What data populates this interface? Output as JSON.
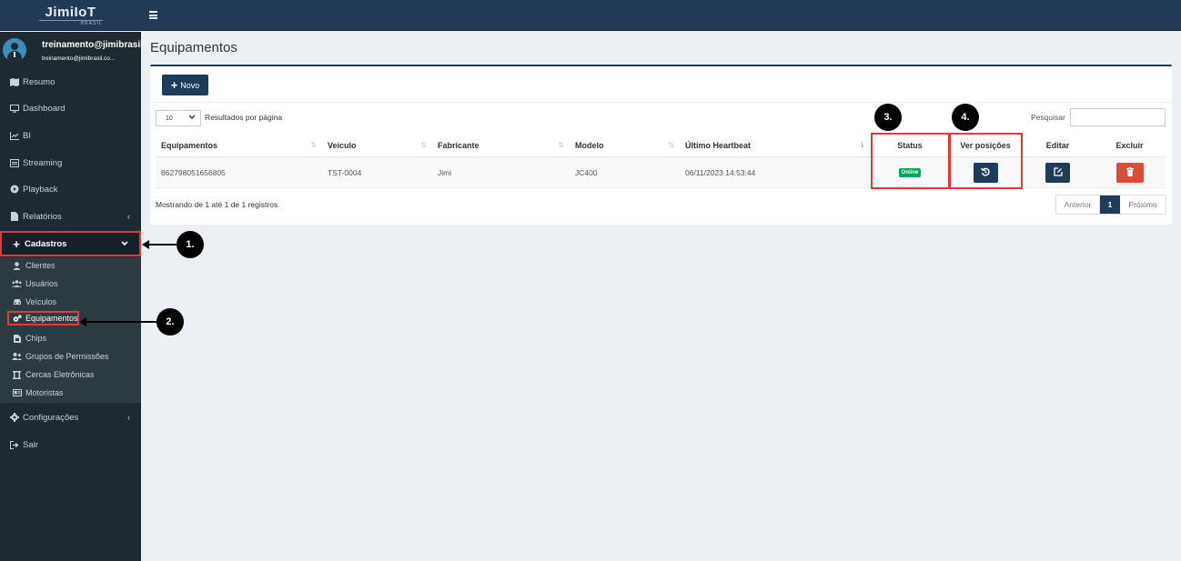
{
  "brand": {
    "logo": "JimiIoT",
    "logo_sub": "BRASIL"
  },
  "user": {
    "name": "treinamento@jimibrasil",
    "email": "treinamento@jimibrasil.co..."
  },
  "nav": {
    "resumo": "Resumo",
    "dashboard": "Dashboard",
    "bi": "BI",
    "streaming": "Streaming",
    "playback": "Playback",
    "relatorios": "Relatórios",
    "cadastros": "Cadastros",
    "configuracoes": "Configurações",
    "sair": "Sair"
  },
  "submenu": {
    "clientes": "Clientes",
    "usuarios": "Usuários",
    "veiculos": "Veículos",
    "equipamentos": "Equipamentos",
    "chips": "Chips",
    "grupos": "Grupos de Permissões",
    "cercas": "Cercas Eletrônicas",
    "motoristas": "Motoristas"
  },
  "page": {
    "title": "Equipamentos"
  },
  "toolbar": {
    "novo_label": "Novo"
  },
  "table_controls": {
    "page_length": "10",
    "page_length_label": "Resultados por página",
    "search_label": "Pesquisar",
    "search_value": ""
  },
  "table": {
    "headers": {
      "equipamentos": "Equipamentos",
      "veiculo": "Veículo",
      "fabricante": "Fabricante",
      "modelo": "Modelo",
      "heartbeat": "Último Heartbeat",
      "status": "Status",
      "ver_posicoes": "Ver posições",
      "editar": "Editar",
      "excluir": "Excluir"
    },
    "rows": [
      {
        "equipamento": "862798051656805",
        "veiculo": "TST-0004",
        "fabricante": "Jimi",
        "modelo": "JC400",
        "heartbeat": "06/11/2023 14:53:44",
        "status": "Online"
      }
    ]
  },
  "footer": {
    "info": "Mostrando de 1 até 1 de 1 registros",
    "prev": "Anterior",
    "current": "1",
    "next": "Próximo"
  },
  "annotations": {
    "m1": "1.",
    "m2": "2.",
    "m3": "3.",
    "m4": "4."
  },
  "colors": {
    "topbar": "#213a56",
    "sidebar": "#1d2a32",
    "primary": "#1f3b5a",
    "success": "#00a65a",
    "danger": "#dd4b39",
    "highlight": "#e53935"
  },
  "icons": [
    "menu-icon",
    "map-icon",
    "monitor-icon",
    "chart-icon",
    "streaming-icon",
    "play-icon",
    "file-icon",
    "plus-icon",
    "chevron-down-icon",
    "chevron-left-icon",
    "user-icon",
    "users-icon",
    "car-icon",
    "cogs-icon",
    "chip-icon",
    "group-icon",
    "fence-icon",
    "id-card-icon",
    "gear-icon",
    "sign-out-icon",
    "history-icon",
    "edit-icon",
    "trash-icon"
  ]
}
